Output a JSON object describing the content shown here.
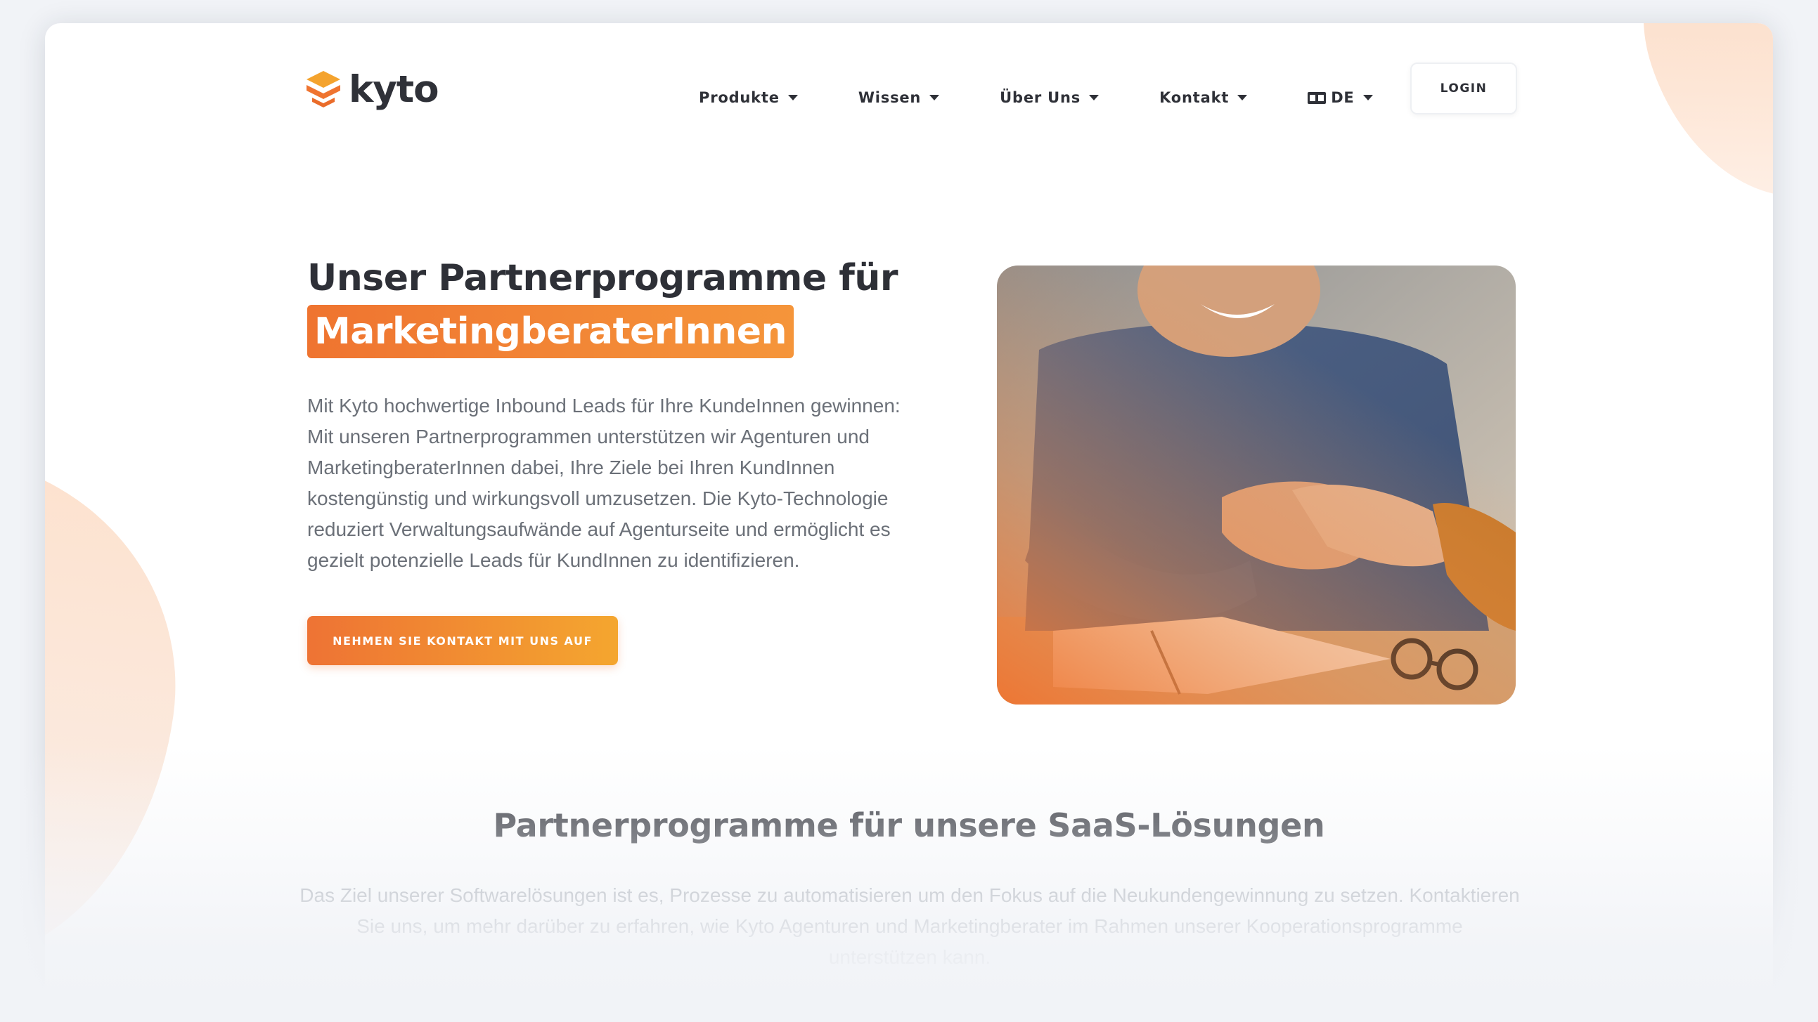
{
  "brand": {
    "name": "kyto",
    "accent": "#ef7430",
    "accent_light": "#f5a32e",
    "text_dark": "#2e3037"
  },
  "nav": {
    "items": [
      {
        "label": "Produkte"
      },
      {
        "label": "Wissen"
      },
      {
        "label": "Über Uns"
      },
      {
        "label": "Kontakt"
      }
    ],
    "language": "DE",
    "language_icon": "translate-icon",
    "login_label": "LOGIN"
  },
  "hero": {
    "title_line1": "Unser Partnerprogramme für",
    "title_highlight": "MarketingberaterInnen",
    "description_lines": [
      "Mit Kyto hochwertige Inbound Leads für Ihre KundeInnen gewinnen:",
      "Mit unseren Partnerprogrammen unterstützen wir Agenturen und",
      "MarketingberaterInnen dabei, Ihre Ziele bei Ihren KundInnen",
      "kostengünstig und wirkungsvoll umzusetzen. Die Kyto-Technologie",
      "reduziert Verwaltungsaufwände auf Agenturseite und ermöglicht es",
      "gezielt potenzielle Leads für KundInnen zu identifizieren."
    ],
    "cta_label": "NEHMEN SIE KONTAKT MIT UNS AUF",
    "image_subject": "handshake-photo"
  },
  "section": {
    "title": "Partnerprogramme für unsere SaaS-Lösungen",
    "description_lines": [
      "Das Ziel unserer Softwarelösungen ist es, Prozesse zu automatisieren um den Fokus auf die Neukundengewinnung zu setzen. Kontaktieren",
      "Sie uns, um mehr darüber zu erfahren, wie Kyto Agenturen und Marketingberater im Rahmen unserer Kooperationsprogramme",
      "unterstützen kann."
    ]
  }
}
